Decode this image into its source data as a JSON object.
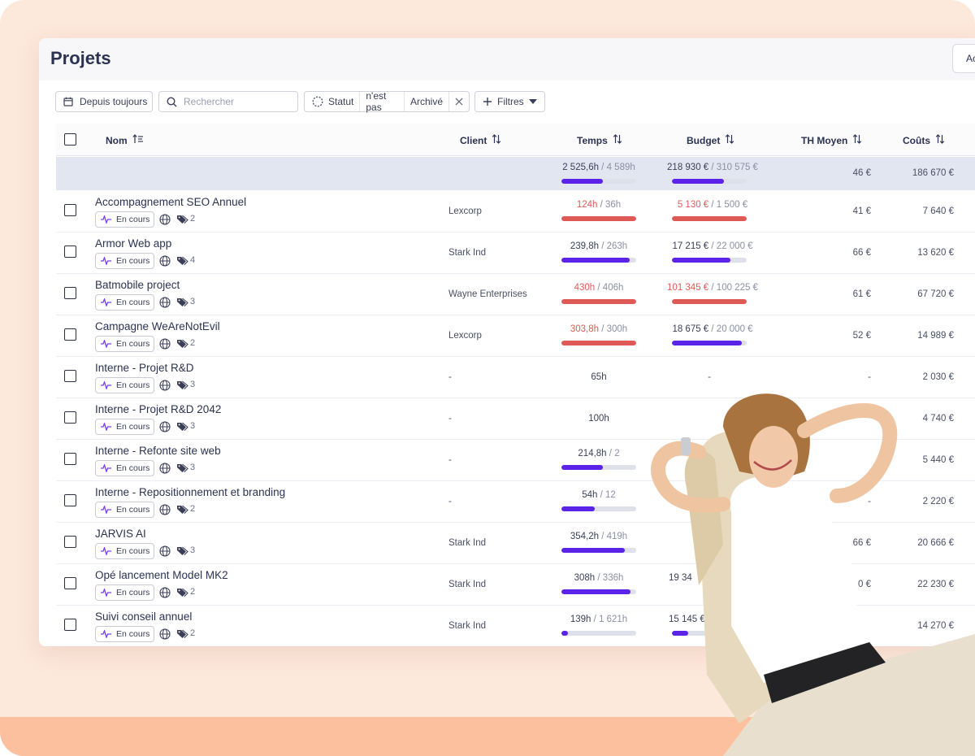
{
  "page": {
    "title": "Projets",
    "top_button_label": "Ac"
  },
  "toolbar": {
    "date_filter": "Depuis toujours",
    "search_placeholder": "Rechercher",
    "status_filter": {
      "field": "Statut",
      "operator": "n'est pas",
      "value": "Archivé"
    },
    "filters_label": "Filtres"
  },
  "table": {
    "headers": {
      "name": "Nom",
      "client": "Client",
      "time": "Temps",
      "budget": "Budget",
      "th": "TH Moyen",
      "costs": "Coûts"
    },
    "totals": {
      "time": "2 525,6h",
      "time_total": "4 589h",
      "time_ratio": 0.55,
      "budget": "218 930 €",
      "budget_total": "310 575 €",
      "budget_ratio": 0.7,
      "th": "46 €",
      "costs": "186 670 €"
    },
    "rows": [
      {
        "name": "Accompagnement SEO Annuel",
        "status": "En cours",
        "tags": "2",
        "client": "Lexcorp",
        "time": "124h",
        "time_total": "36h",
        "time_over": true,
        "time_ratio": 1.0,
        "budget": "5 130 €",
        "budget_total": "1 500 €",
        "budget_over": true,
        "budget_ratio": 1.0,
        "th": "41 €",
        "costs": "7 640 €"
      },
      {
        "name": "Armor Web app",
        "status": "En cours",
        "tags": "4",
        "client": "Stark Ind",
        "time": "239,8h",
        "time_total": "263h",
        "time_over": false,
        "time_ratio": 0.91,
        "budget": "17 215 €",
        "budget_total": "22 000 €",
        "budget_over": false,
        "budget_ratio": 0.78,
        "th": "66 €",
        "costs": "13 620 €"
      },
      {
        "name": "Batmobile project",
        "status": "En cours",
        "tags": "3",
        "client": "Wayne Enterprises",
        "time": "430h",
        "time_total": "406h",
        "time_over": true,
        "time_ratio": 1.0,
        "budget": "101 345 €",
        "budget_total": "100 225 €",
        "budget_over": true,
        "budget_ratio": 1.0,
        "th": "61 €",
        "costs": "67 720 €"
      },
      {
        "name": "Campagne WeAreNotEvil",
        "status": "En cours",
        "tags": "2",
        "client": "Lexcorp",
        "time": "303,8h",
        "time_total": "300h",
        "time_over": true,
        "time_ratio": 1.0,
        "budget": "18 675 €",
        "budget_total": "20 000 €",
        "budget_over": false,
        "budget_ratio": 0.93,
        "th": "52 €",
        "costs": "14 989 €"
      },
      {
        "name": "Interne - Projet R&D",
        "status": "En cours",
        "tags": "3",
        "client": "-",
        "time_plain": "65h",
        "budget_plain": "-",
        "th": "-",
        "costs": "2 030 €"
      },
      {
        "name": "Interne - Projet R&D 2042",
        "status": "En cours",
        "tags": "3",
        "client": "-",
        "time_plain": "100h",
        "costs": "4 740 €"
      },
      {
        "name": "Interne - Refonte site web",
        "status": "En cours",
        "tags": "3",
        "client": "-",
        "time": "214,8h",
        "time_total": "2",
        "time_over": false,
        "time_ratio": 0.55,
        "costs": "5 440 €"
      },
      {
        "name": "Interne - Repositionnement et branding",
        "status": "En cours",
        "tags": "2",
        "client": "-",
        "time": "54h",
        "time_total": "12",
        "time_over": false,
        "time_ratio": 0.45,
        "th": "-",
        "costs": "2 220 €"
      },
      {
        "name": "JARVIS AI",
        "status": "En cours",
        "tags": "3",
        "client": "Stark Ind",
        "time": "354,2h",
        "time_total": "419h",
        "time_over": false,
        "time_ratio": 0.85,
        "th": "66 €",
        "costs": "20 666 €"
      },
      {
        "name": "Opé lancement Model MK2",
        "status": "En cours",
        "tags": "2",
        "client": "Stark Ind",
        "time": "308h",
        "time_total": "336h",
        "time_over": false,
        "time_ratio": 0.92,
        "budget_partial": "19 34",
        "th": "0 €",
        "costs": "22 230 €"
      },
      {
        "name": "Suivi conseil annuel",
        "status": "En cours",
        "tags": "2",
        "client": "Stark Ind",
        "time": "139h",
        "time_total": "1 621h",
        "time_over": false,
        "time_ratio": 0.09,
        "budget_partial": "15 145 €",
        "budget_ratio": 0.22,
        "costs": "14 270 €"
      }
    ]
  },
  "colors": {
    "accent": "#5b22e8",
    "over_budget": "#e05a55",
    "status_icon": "#7a3cf0"
  },
  "icons": {
    "date": "calendar-icon",
    "search": "search-icon",
    "status": "dashed-circle-icon",
    "clear": "close-icon",
    "add": "plus-icon",
    "dropdown": "caret-down-icon",
    "sort": "sort-icon",
    "status_badge": "activity-icon",
    "visibility": "globe-icon",
    "tags": "tag-icon"
  }
}
